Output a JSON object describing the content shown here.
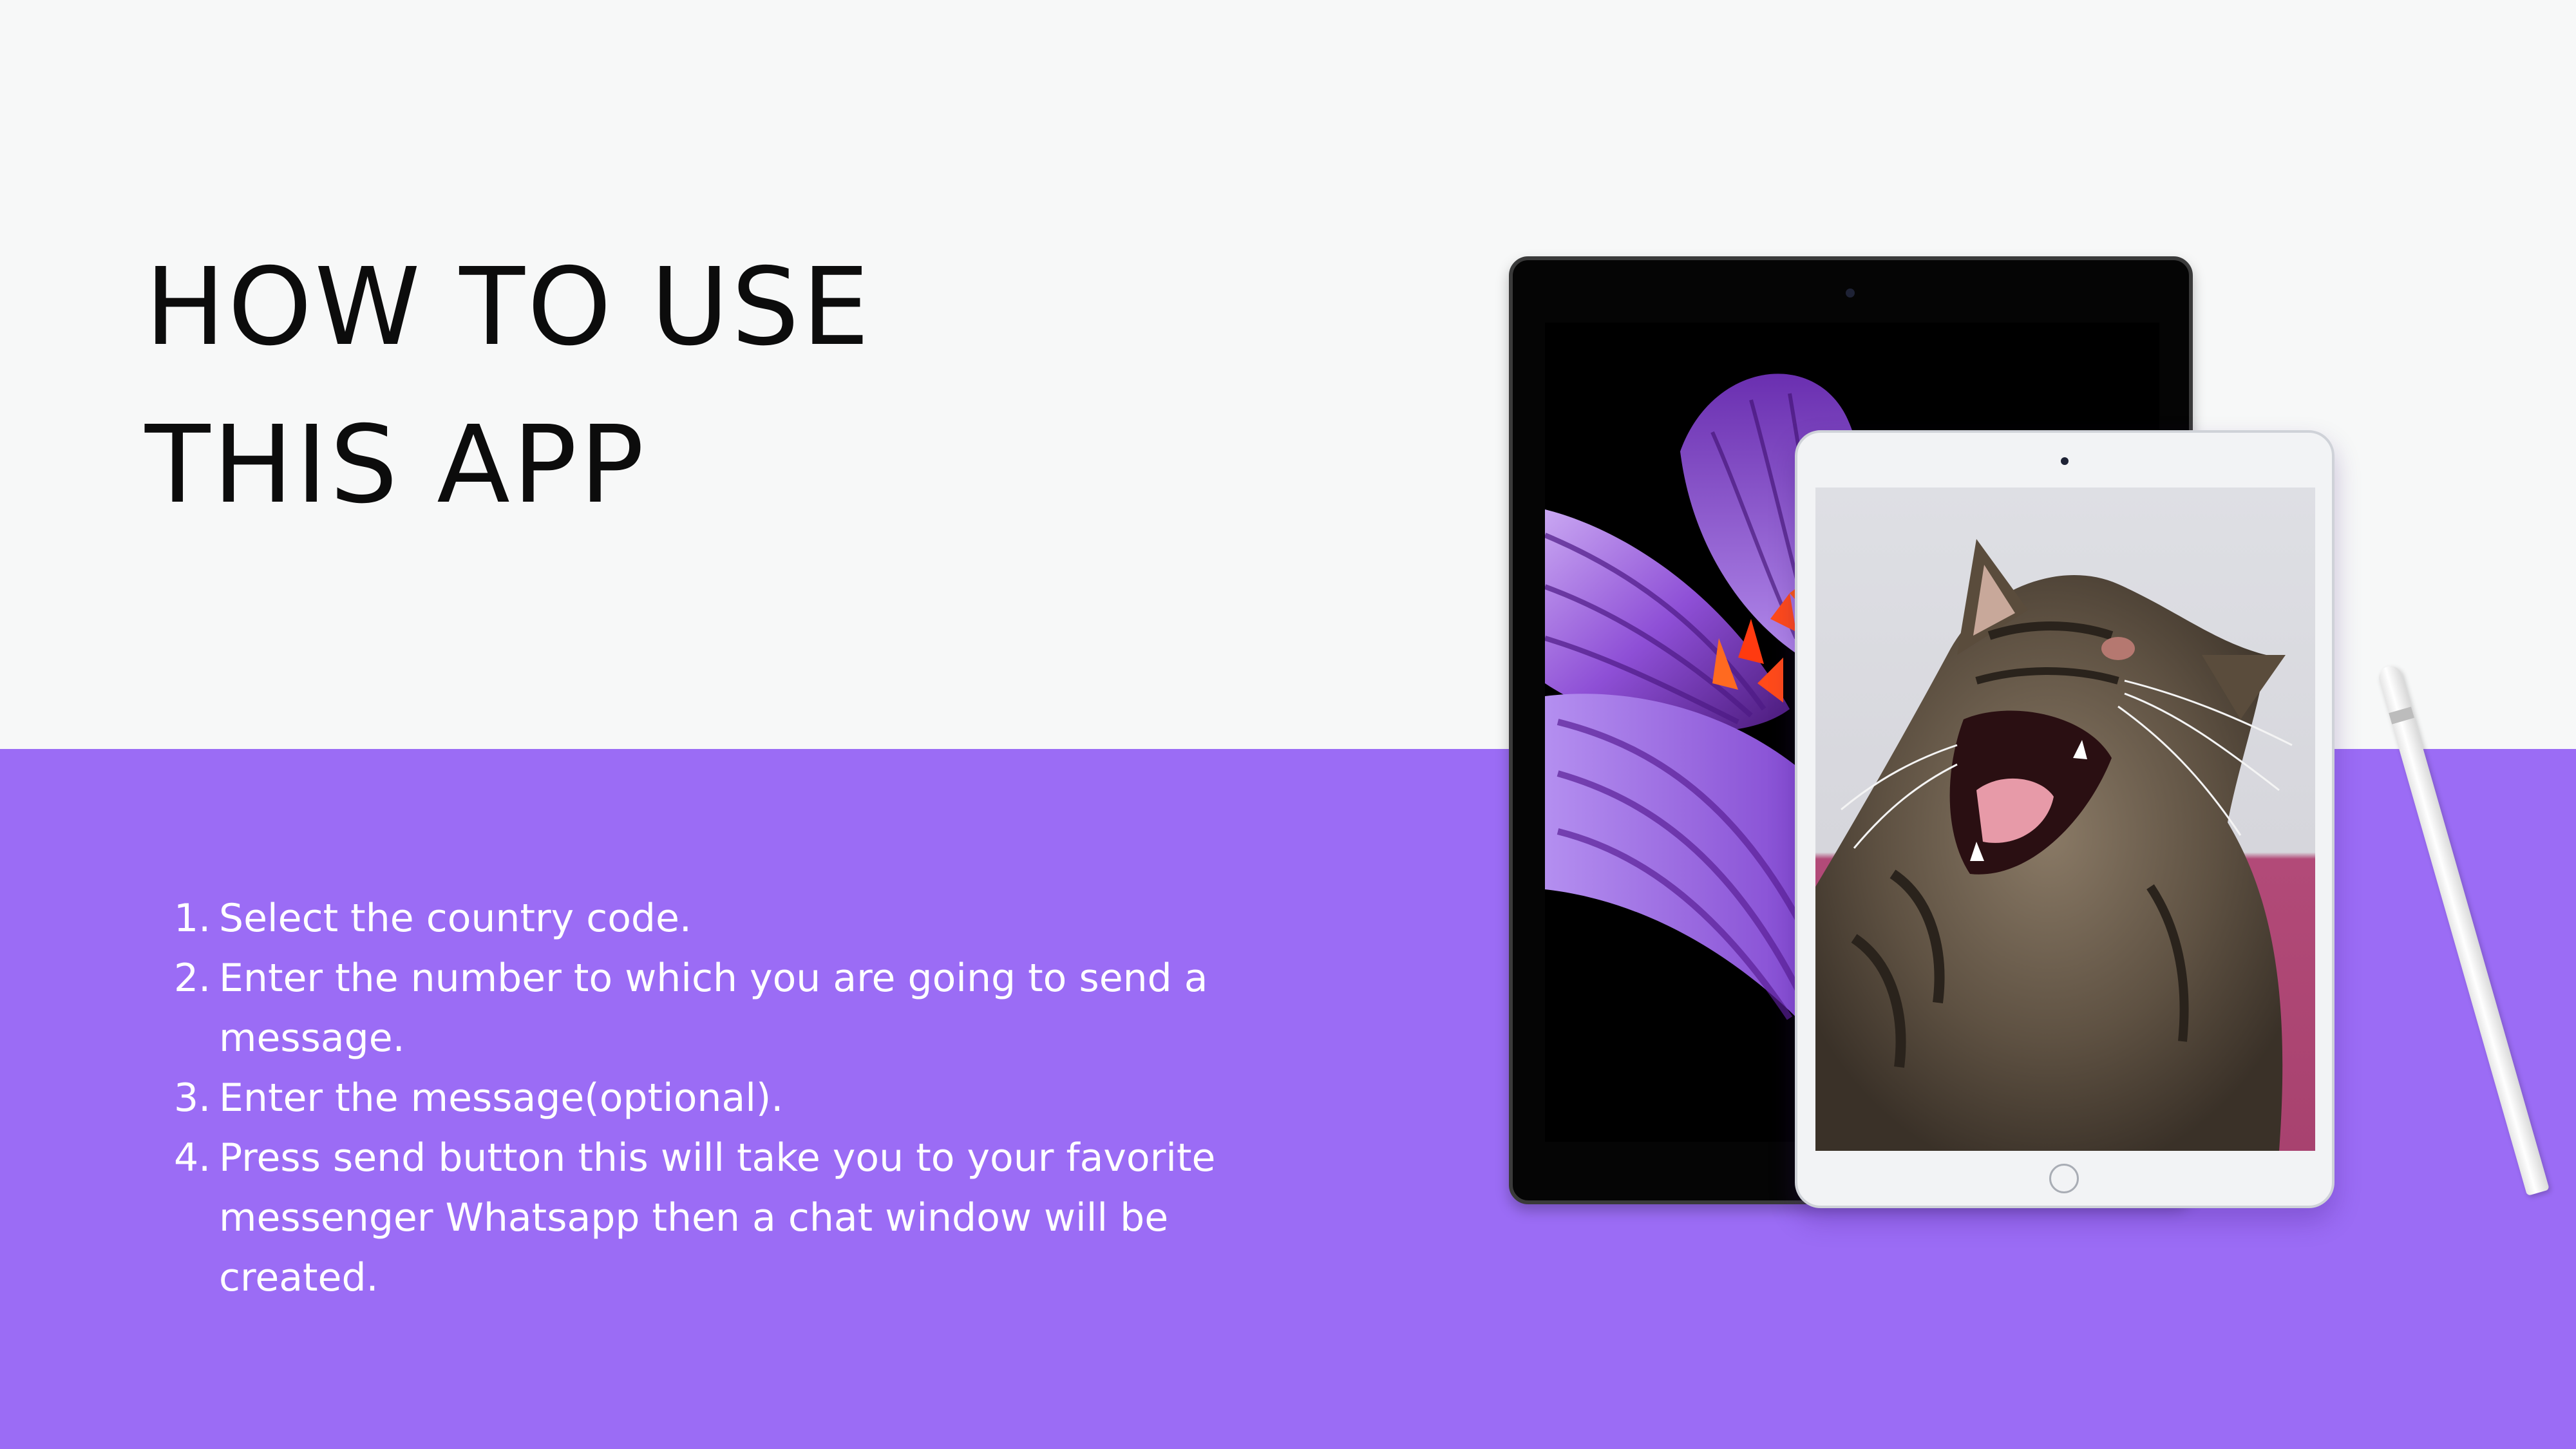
{
  "title": {
    "line1": "HOW TO USE",
    "line2": "THIS APP"
  },
  "steps": [
    {
      "num": "1.",
      "text": " Select the country code."
    },
    {
      "num": "2.",
      "text": " Enter the number to which you are going to send a message."
    },
    {
      "num": "3.",
      "text": "Enter the message(optional)."
    },
    {
      "num": "4.",
      "text": "Press send button this will take you to your favorite messenger Whatsapp then a chat window will be created."
    }
  ],
  "colors": {
    "background_top": "#f7f8f8",
    "background_bottom": "#9b6cf5",
    "title_text": "#0c0c0c",
    "step_text": "#ffffff"
  },
  "images": {
    "large_tablet_screen": "purple-crocus-flower",
    "small_tablet_screen": "yawning-tabby-cat",
    "accessory": "stylus-pencil"
  }
}
